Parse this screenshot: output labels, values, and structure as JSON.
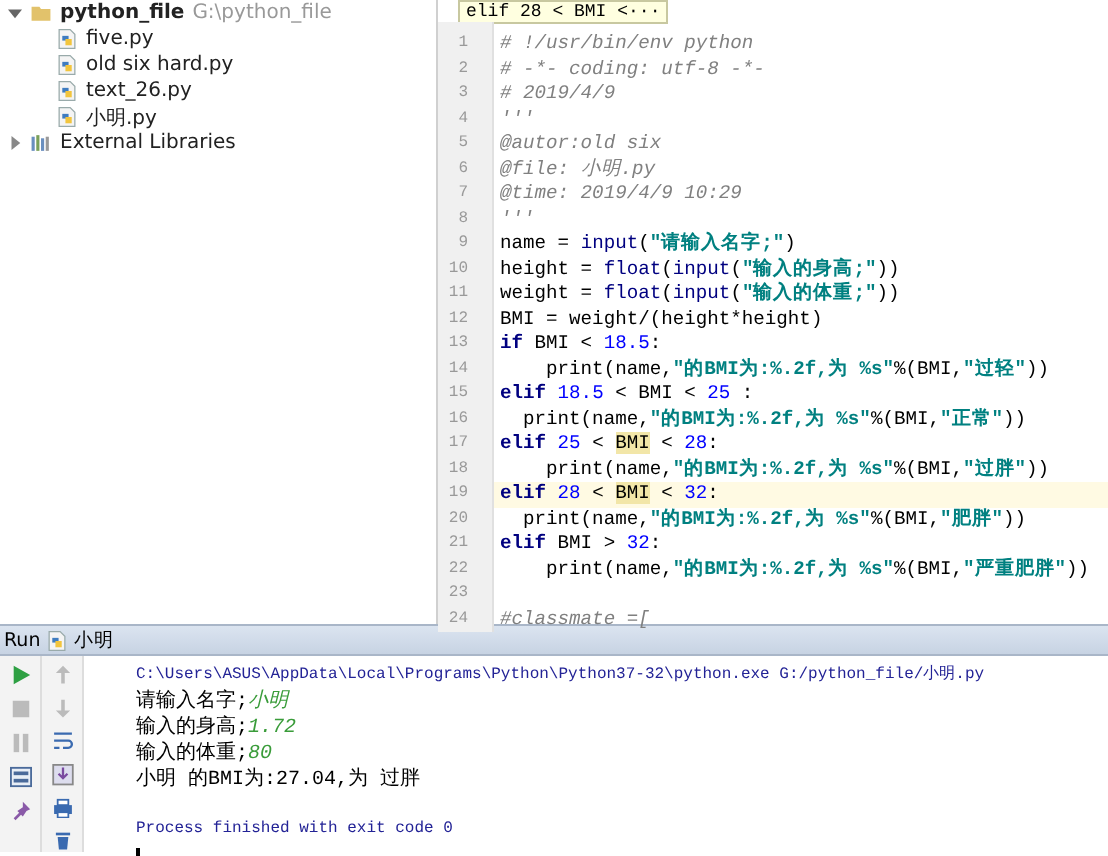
{
  "project_tree": {
    "folder": {
      "name": "python_file",
      "path": "G:\\python_file",
      "expanded": true,
      "children": [
        {
          "name": "five.py"
        },
        {
          "name": "old six hard.py"
        },
        {
          "name": "text_26.py"
        },
        {
          "name": "小明.py"
        }
      ]
    },
    "libraries": {
      "name": "External Libraries",
      "expanded": false
    }
  },
  "editor": {
    "breadcrumb": "elif 28 < BMI <···",
    "lines": [
      {
        "number": "1",
        "current": false,
        "segments": [
          {
            "kind": "comment",
            "text": "# !/usr/bin/env python"
          }
        ]
      },
      {
        "number": "2",
        "current": false,
        "segments": [
          {
            "kind": "comment",
            "text": "# -*- coding: utf-8 -*-"
          }
        ]
      },
      {
        "number": "3",
        "current": false,
        "segments": [
          {
            "kind": "comment",
            "text": "# 2019/4/9"
          }
        ]
      },
      {
        "number": "4",
        "current": false,
        "segments": [
          {
            "kind": "comment",
            "text": "'''"
          }
        ]
      },
      {
        "number": "5",
        "current": false,
        "segments": [
          {
            "kind": "comment",
            "text": "@autor:old six"
          }
        ]
      },
      {
        "number": "6",
        "current": false,
        "segments": [
          {
            "kind": "comment",
            "text": "@file: 小明.py"
          }
        ]
      },
      {
        "number": "7",
        "current": false,
        "segments": [
          {
            "kind": "comment",
            "text": "@time: 2019/4/9 10:29"
          }
        ]
      },
      {
        "number": "8",
        "current": false,
        "segments": [
          {
            "kind": "comment",
            "text": "'''"
          }
        ]
      },
      {
        "number": "9",
        "current": false,
        "segments": [
          {
            "kind": "plain",
            "text": "name = "
          },
          {
            "kind": "builtin",
            "text": "input"
          },
          {
            "kind": "plain",
            "text": "("
          },
          {
            "kind": "string",
            "text": "\"请输入名字;\""
          },
          {
            "kind": "plain",
            "text": ")"
          }
        ]
      },
      {
        "number": "10",
        "current": false,
        "segments": [
          {
            "kind": "plain",
            "text": "height = "
          },
          {
            "kind": "builtin",
            "text": "float"
          },
          {
            "kind": "plain",
            "text": "("
          },
          {
            "kind": "builtin",
            "text": "input"
          },
          {
            "kind": "plain",
            "text": "("
          },
          {
            "kind": "string",
            "text": "\"输入的身高;\""
          },
          {
            "kind": "plain",
            "text": "))"
          }
        ]
      },
      {
        "number": "11",
        "current": false,
        "segments": [
          {
            "kind": "plain",
            "text": "weight = "
          },
          {
            "kind": "builtin",
            "text": "float"
          },
          {
            "kind": "plain",
            "text": "("
          },
          {
            "kind": "builtin",
            "text": "input"
          },
          {
            "kind": "plain",
            "text": "("
          },
          {
            "kind": "string",
            "text": "\"输入的体重;\""
          },
          {
            "kind": "plain",
            "text": "))"
          }
        ]
      },
      {
        "number": "12",
        "current": false,
        "segments": [
          {
            "kind": "plain",
            "text": "BMI = weight/(height*height)"
          }
        ]
      },
      {
        "number": "13",
        "current": false,
        "segments": [
          {
            "kind": "keyword",
            "text": "if"
          },
          {
            "kind": "plain",
            "text": " BMI < "
          },
          {
            "kind": "number",
            "text": "18.5"
          },
          {
            "kind": "plain",
            "text": ":"
          }
        ]
      },
      {
        "number": "14",
        "current": false,
        "segments": [
          {
            "kind": "plain",
            "text": "    print(name,"
          },
          {
            "kind": "string",
            "text": "\"的BMI为:%.2f,为 %s\""
          },
          {
            "kind": "plain",
            "text": "%(BMI,"
          },
          {
            "kind": "string",
            "text": "\"过轻\""
          },
          {
            "kind": "plain",
            "text": "))"
          }
        ]
      },
      {
        "number": "15",
        "current": false,
        "segments": [
          {
            "kind": "keyword",
            "text": "elif "
          },
          {
            "kind": "number",
            "text": "18.5"
          },
          {
            "kind": "plain",
            "text": " < BMI < "
          },
          {
            "kind": "number",
            "text": "25"
          },
          {
            "kind": "plain",
            "text": " :"
          }
        ]
      },
      {
        "number": "16",
        "current": false,
        "segments": [
          {
            "kind": "plain",
            "text": "  print(name,"
          },
          {
            "kind": "string",
            "text": "\"的BMI为:%.2f,为 %s\""
          },
          {
            "kind": "plain",
            "text": "%(BMI,"
          },
          {
            "kind": "string",
            "text": "\"正常\""
          },
          {
            "kind": "plain",
            "text": "))"
          }
        ]
      },
      {
        "number": "17",
        "current": false,
        "segments": [
          {
            "kind": "keyword",
            "text": "elif "
          },
          {
            "kind": "number",
            "text": "25"
          },
          {
            "kind": "plain",
            "text": " < "
          },
          {
            "kind": "match",
            "text": "BMI"
          },
          {
            "kind": "plain",
            "text": " < "
          },
          {
            "kind": "number",
            "text": "28"
          },
          {
            "kind": "plain",
            "text": ":"
          }
        ]
      },
      {
        "number": "18",
        "current": false,
        "segments": [
          {
            "kind": "plain",
            "text": "    print(name,"
          },
          {
            "kind": "string",
            "text": "\"的BMI为:%.2f,为 %s\""
          },
          {
            "kind": "plain",
            "text": "%(BMI,"
          },
          {
            "kind": "string",
            "text": "\"过胖\""
          },
          {
            "kind": "plain",
            "text": "))"
          }
        ]
      },
      {
        "number": "19",
        "current": true,
        "segments": [
          {
            "kind": "keyword",
            "text": "elif "
          },
          {
            "kind": "number",
            "text": "28"
          },
          {
            "kind": "plain",
            "text": " < "
          },
          {
            "kind": "match",
            "text": "BMI"
          },
          {
            "kind": "plain",
            "text": " < "
          },
          {
            "kind": "number",
            "text": "32"
          },
          {
            "kind": "plain",
            "text": ":"
          }
        ]
      },
      {
        "number": "20",
        "current": false,
        "segments": [
          {
            "kind": "plain",
            "text": "  print(name,"
          },
          {
            "kind": "string",
            "text": "\"的BMI为:%.2f,为 %s\""
          },
          {
            "kind": "plain",
            "text": "%(BMI,"
          },
          {
            "kind": "string",
            "text": "\"肥胖\""
          },
          {
            "kind": "plain",
            "text": "))"
          }
        ]
      },
      {
        "number": "21",
        "current": false,
        "segments": [
          {
            "kind": "keyword",
            "text": "elif"
          },
          {
            "kind": "plain",
            "text": " BMI > "
          },
          {
            "kind": "number",
            "text": "32"
          },
          {
            "kind": "plain",
            "text": ":"
          }
        ]
      },
      {
        "number": "22",
        "current": false,
        "segments": [
          {
            "kind": "plain",
            "text": "    print(name,"
          },
          {
            "kind": "string",
            "text": "\"的BMI为:%.2f,为 %s\""
          },
          {
            "kind": "plain",
            "text": "%(BMI,"
          },
          {
            "kind": "string",
            "text": "\"严重肥胖\""
          },
          {
            "kind": "plain",
            "text": "))"
          }
        ]
      },
      {
        "number": "23",
        "current": false
      },
      {
        "number": "24",
        "current": false,
        "segments": [
          {
            "kind": "comment",
            "text": "#classmate =["
          }
        ]
      }
    ]
  },
  "run_panel": {
    "label": "Run",
    "config": "小明",
    "console": [
      {
        "segments": [
          {
            "kind": "system",
            "text": "C:\\Users\\ASUS\\AppData\\Local\\Programs\\Python\\Python37-32\\python.exe G:/python_file/小明.py"
          }
        ]
      },
      {
        "segments": [
          {
            "kind": "output",
            "text": "请输入名字;"
          },
          {
            "kind": "input",
            "text": "小明"
          }
        ]
      },
      {
        "segments": [
          {
            "kind": "output",
            "text": "输入的身高;"
          },
          {
            "kind": "input",
            "text": "1.72"
          }
        ]
      },
      {
        "segments": [
          {
            "kind": "output",
            "text": "输入的体重;"
          },
          {
            "kind": "input",
            "text": "80"
          }
        ]
      },
      {
        "segments": [
          {
            "kind": "output",
            "text": "小明 的BMI为:27.04,为 过胖"
          }
        ]
      },
      {
        "blank_line_before": true,
        "segments": [
          {
            "kind": "system",
            "text": "Process finished with exit code 0"
          }
        ]
      }
    ]
  }
}
